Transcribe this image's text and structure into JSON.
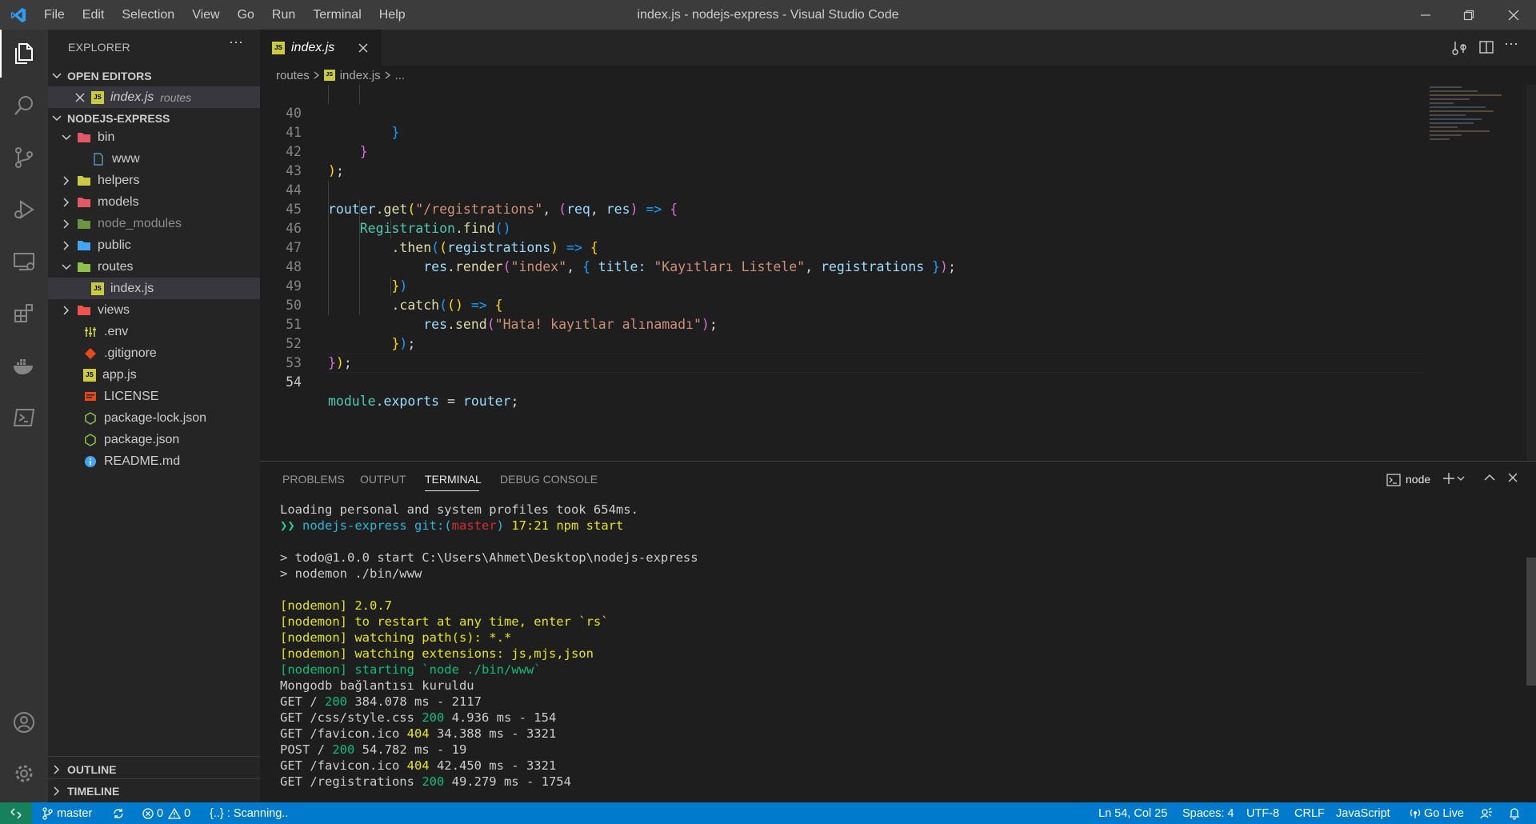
{
  "window": {
    "title": "index.js - nodejs-express - Visual Studio Code",
    "menu": [
      "File",
      "Edit",
      "Selection",
      "View",
      "Go",
      "Run",
      "Terminal",
      "Help"
    ]
  },
  "sidebar": {
    "header": "EXPLORER",
    "open_editors_title": "OPEN EDITORS",
    "open_editor": {
      "name": "index.js",
      "folder": "routes"
    },
    "project_title": "NODEJS-EXPRESS",
    "tree": [
      {
        "label": "bin"
      },
      {
        "label": "www"
      },
      {
        "label": "helpers"
      },
      {
        "label": "models"
      },
      {
        "label": "node_modules"
      },
      {
        "label": "public"
      },
      {
        "label": "routes"
      },
      {
        "label": "index.js"
      },
      {
        "label": "views"
      },
      {
        "label": ".env"
      },
      {
        "label": ".gitignore"
      },
      {
        "label": "app.js"
      },
      {
        "label": "LICENSE"
      },
      {
        "label": "package-lock.json"
      },
      {
        "label": "package.json"
      },
      {
        "label": "README.md"
      }
    ],
    "outline_title": "OUTLINE",
    "timeline_title": "TIMELINE"
  },
  "editor": {
    "tab_label": "index.js",
    "breadcrumb": [
      "routes",
      "index.js",
      "..."
    ],
    "line_numbers": [
      "40",
      "41",
      "42",
      "43",
      "44",
      "45",
      "46",
      "47",
      "48",
      "49",
      "50",
      "51",
      "52",
      "53",
      "54"
    ],
    "tokens": {
      "l40": "}",
      "l41": "}",
      "l42a": ")",
      "l42b": ";",
      "l44_router": "router",
      "l44_get": ".get",
      "l44_p": "(",
      "l44_str": "\"/registrations\"",
      "l44_comma": ", ",
      "l44_p2": "(",
      "l44_req": "req",
      "l44_c2": ", ",
      "l44_res": "res",
      "l44_p2c": ")",
      "l44_arrow": " => ",
      "l44_brace": "{",
      "l45_reg": "Registration",
      "l45_find": ".find",
      "l45_pp": "()",
      "l46_then": ".then",
      "l46_p": "(",
      "l46_p2": "(",
      "l46_regs": "registrations",
      "l46_p2c": ")",
      "l46_arrow": " => ",
      "l46_brace": "{",
      "l47_res": "res",
      "l47_render": ".render",
      "l47_p": "(",
      "l47_str": "\"index\"",
      "l47_comma": ", ",
      "l47_brace": "{",
      "l47_title": " title",
      "l47_colon": ": ",
      "l47_str2": "\"Kayıtları Listele\"",
      "l47_comma2": ", ",
      "l47_regs": "registrations",
      "l47_bc": " }",
      "l47_pc": ")",
      "l47_semi": ";",
      "l48_brace": "}",
      "l48_paren": ")",
      "l49_catch": ".catch",
      "l49_p": "(",
      "l49_pp": "()",
      "l49_arrow": " => ",
      "l49_brace": "{",
      "l50_res": "res",
      "l50_send": ".send",
      "l50_p": "(",
      "l50_str": "\"Hata! kayıtlar alınamadı\"",
      "l50_pc": ")",
      "l50_semi": ";",
      "l51_brace": "}",
      "l51_paren": ")",
      "l51_semi": ";",
      "l52_brace": "}",
      "l52_paren": ")",
      "l52_semi": ";",
      "l54_module": "module",
      "l54_exports": ".exports",
      "l54_eq": " = ",
      "l54_router": "router",
      "l54_semi": ";"
    }
  },
  "panel": {
    "tabs": [
      "PROBLEMS",
      "OUTPUT",
      "TERMINAL",
      "DEBUG CONSOLE"
    ],
    "active_tab": "TERMINAL",
    "terminal_name": "node",
    "terminal": {
      "t1": "Loading personal and system profiles took 654ms.",
      "t2_prompt": "❯❯ ",
      "t2_dir": "nodejs-express ",
      "t2_git": "git:(",
      "t2_branch": "master",
      "t2_gitc": ") ",
      "t2_time": "17:21 ",
      "t2_cmd": "npm start",
      "t3": "> todo@1.0.0 start C:\\Users\\Ahmet\\Desktop\\nodejs-express",
      "t4": "> nodemon ./bin/www",
      "t5": "[nodemon] 2.0.7",
      "t6": "[nodemon] to restart at any time, enter `rs`",
      "t7": "[nodemon] watching path(s): *.*",
      "t8": "[nodemon] watching extensions: js,mjs,json",
      "t9": "[nodemon] starting `node ./bin/www`",
      "t10": "Mongodb bağlantısı kuruldu",
      "r1a": "GET / ",
      "r1s": "200",
      "r1b": " 384.078 ms - 2117",
      "r2a": "GET /css/style.css ",
      "r2s": "200",
      "r2b": " 4.936 ms - 154",
      "r3a": "GET /favicon.ico ",
      "r3s": "404",
      "r3b": " 34.388 ms - 3321",
      "r4a": "POST / ",
      "r4s": "200",
      "r4b": " 54.782 ms - 19",
      "r5a": "GET /favicon.ico ",
      "r5s": "404",
      "r5b": " 42.450 ms - 3321",
      "r6a": "GET /registrations ",
      "r6s": "200",
      "r6b": " 49.279 ms - 1754"
    }
  },
  "status": {
    "branch": "master",
    "errors": "0",
    "warnings": "0",
    "scanning": "{..} : Scanning..",
    "position": "Ln 54, Col 25",
    "spaces": "Spaces: 4",
    "encoding": "UTF-8",
    "eol": "CRLF",
    "language": "JavaScript",
    "golive": "Go Live"
  },
  "colors": {
    "accent": "#007acc",
    "remote": "#16825d",
    "titlebar": "#3c3c3c",
    "activitybar": "#333333",
    "sidebar": "#252526",
    "editor": "#1e1e1e"
  }
}
